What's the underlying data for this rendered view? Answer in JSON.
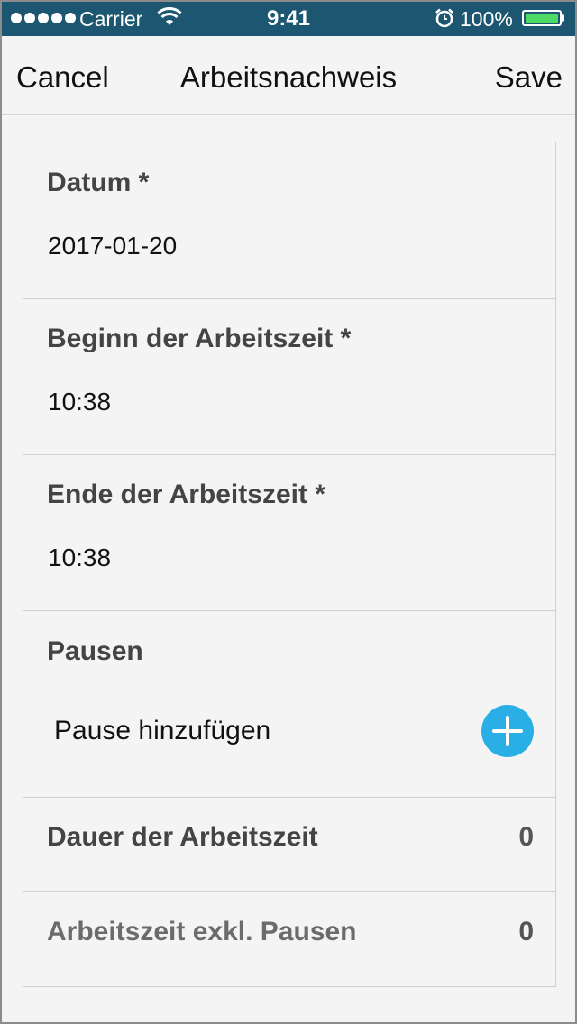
{
  "status_bar": {
    "carrier": "Carrier",
    "time": "9:41",
    "battery": "100%"
  },
  "nav": {
    "cancel": "Cancel",
    "title": "Arbeitsnachweis",
    "save": "Save"
  },
  "form": {
    "date_label": "Datum *",
    "date_value": "2017-01-20",
    "start_label": "Beginn der Arbeitszeit *",
    "start_value": "10:38",
    "end_label": "Ende der Arbeitszeit *",
    "end_value": "10:38",
    "breaks_label": "Pausen",
    "add_break": "Pause hinzufügen",
    "duration_label": "Dauer der Arbeitszeit",
    "duration_value": "0",
    "net_label": "Arbeitszeit exkl. Pausen",
    "net_value": "0"
  },
  "colors": {
    "status_bar": "#1d5670",
    "accent": "#29aee6",
    "battery": "#4cd964"
  }
}
